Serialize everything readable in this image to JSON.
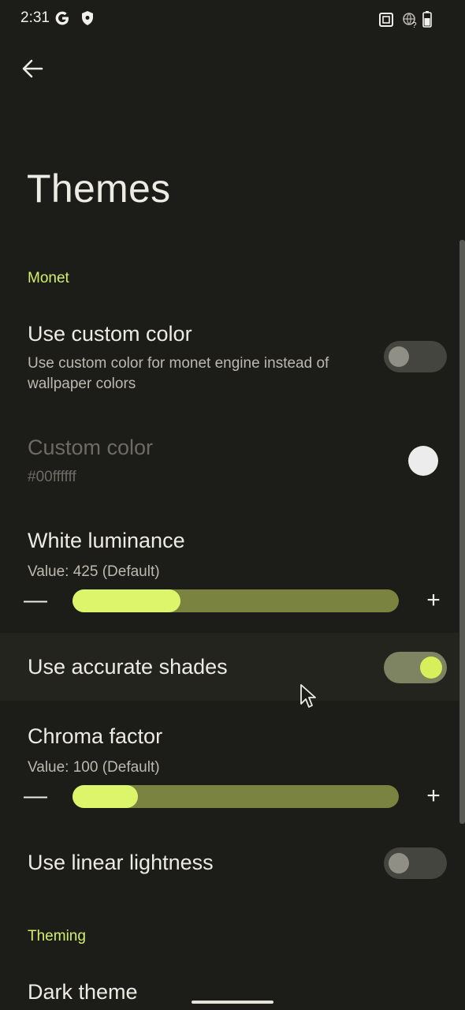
{
  "status_bar": {
    "time": "2:31",
    "left_icons": [
      "google-g-icon",
      "shield-icon"
    ],
    "right_icons": [
      "nfc-icon",
      "network-question-icon",
      "battery-icon"
    ]
  },
  "header": {
    "back_icon": "arrow-back-icon",
    "title": "Themes"
  },
  "sections": {
    "monet": "Monet",
    "theming": "Theming"
  },
  "items": {
    "use_custom_color": {
      "title": "Use custom color",
      "subtitle": "Use custom color for monet engine instead of wallpaper colors",
      "enabled": false
    },
    "custom_color": {
      "title": "Custom color",
      "value": "#00ffffff",
      "swatch_color": "#ececec"
    },
    "white_luminance": {
      "title": "White luminance",
      "value_text": "Value: 425 (Default)",
      "minus": "—",
      "plus": "+",
      "fill_fraction": 0.33
    },
    "use_accurate_shades": {
      "title": "Use accurate shades",
      "enabled": true
    },
    "chroma_factor": {
      "title": "Chroma factor",
      "value_text": "Value: 100 (Default)",
      "minus": "—",
      "plus": "+",
      "fill_fraction": 0.2
    },
    "use_linear_lightness": {
      "title": "Use linear lightness",
      "enabled": false
    },
    "dark_theme": {
      "title": "Dark theme"
    }
  },
  "colors": {
    "background": "#1c1c18",
    "accent": "#d6ef6a",
    "track": "#7a8440"
  }
}
